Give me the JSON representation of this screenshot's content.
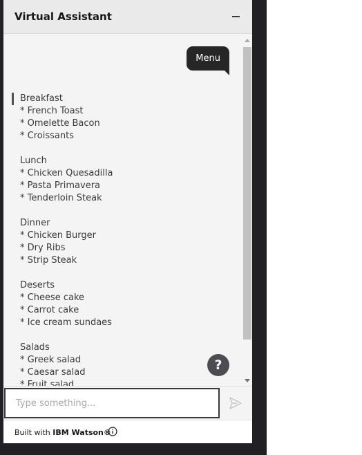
{
  "header": {
    "title": "Virtual Assistant"
  },
  "chat": {
    "user_message": "Menu",
    "menu": [
      {
        "heading": "Breakfast",
        "items": [
          "* French Toast",
          "* Omelette Bacon",
          "* Croissants"
        ]
      },
      {
        "heading": "Lunch",
        "items": [
          "* Chicken Quesadilla",
          "* Pasta Primavera",
          "* Tenderloin Steak"
        ]
      },
      {
        "heading": "Dinner",
        "items": [
          "* Chicken Burger",
          "* Dry Ribs",
          "* Strip Steak"
        ]
      },
      {
        "heading": "Deserts",
        "items": [
          "* Cheese cake",
          "* Carrot cake",
          "* Ice cream sundaes"
        ]
      },
      {
        "heading": "Salads",
        "items": [
          "* Greek salad",
          "* Caesar salad",
          "* Fruit salad"
        ]
      }
    ]
  },
  "help": {
    "label": "?"
  },
  "input": {
    "placeholder": "Type something...",
    "value": ""
  },
  "footer": {
    "prefix": "Built with ",
    "brand": "IBM Watson®"
  },
  "icons": {
    "minimize": "minimize-icon",
    "send": "send-icon",
    "info": "info-icon",
    "help": "help-icon"
  },
  "colors": {
    "user_bubble": "#262626",
    "panel_background": "#f4f4f4",
    "help_button": "#4c4c52"
  }
}
